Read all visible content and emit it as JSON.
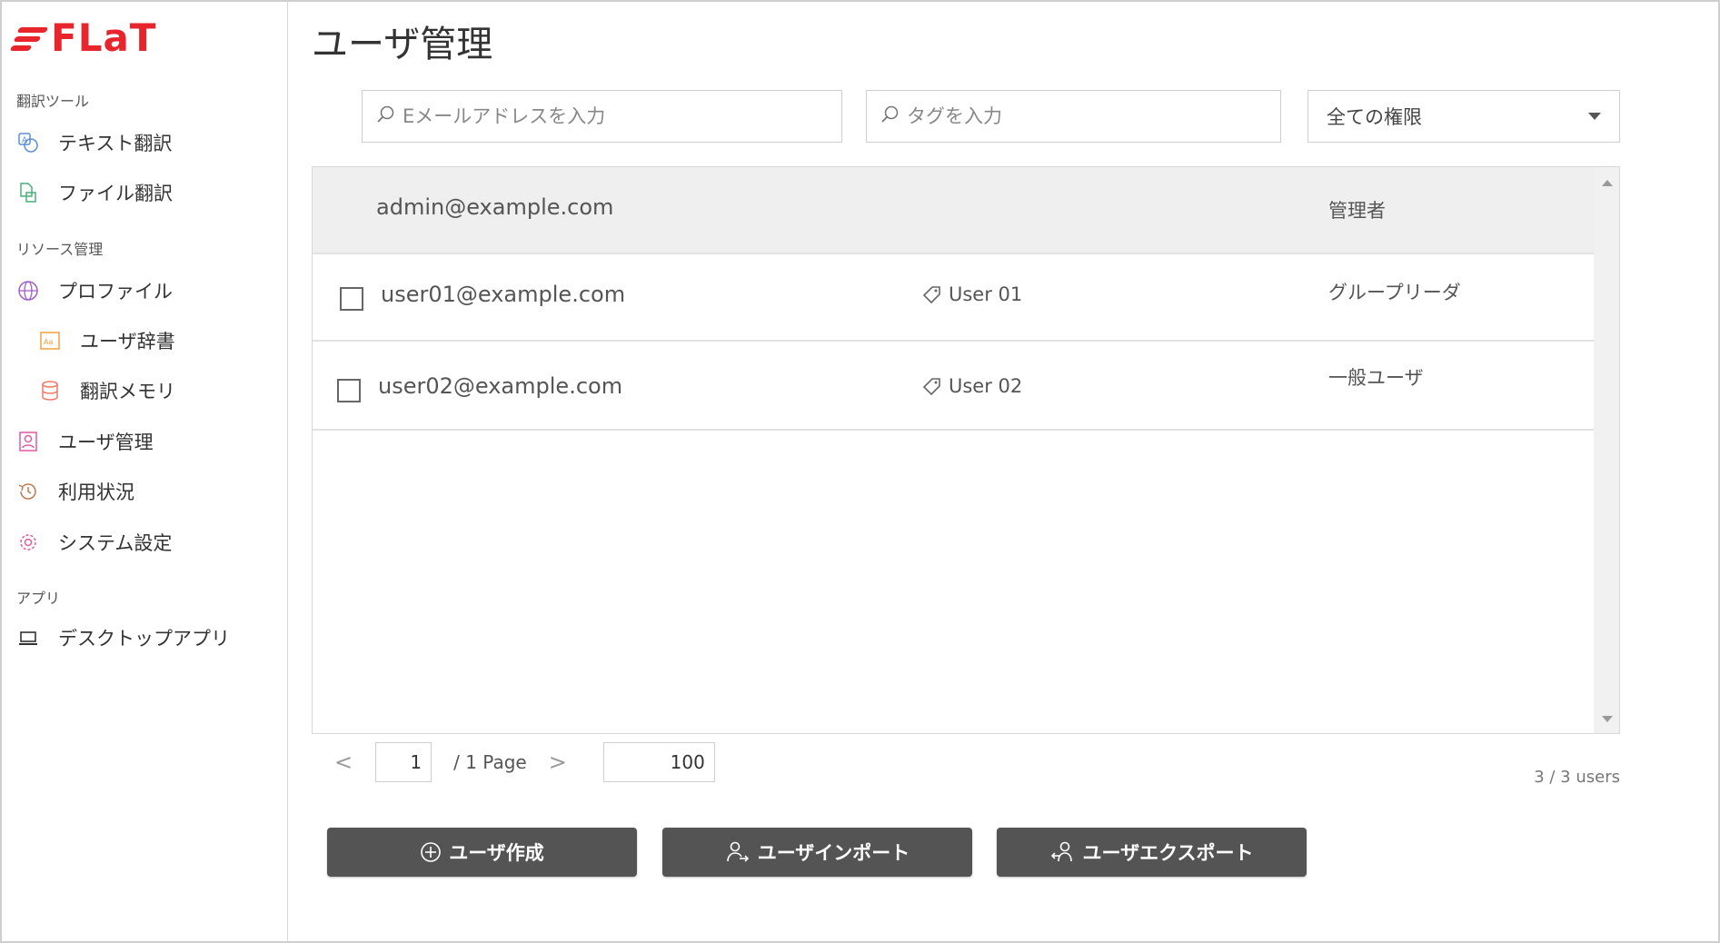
{
  "brand": {
    "name": "FLaT",
    "color": "#e8242c"
  },
  "sidebar": {
    "sections": [
      {
        "label": "翻訳ツール"
      },
      {
        "label": "リソース管理"
      },
      {
        "label": "アプリ"
      }
    ],
    "items": [
      {
        "label": "テキスト翻訳",
        "icon": "text-translate-icon"
      },
      {
        "label": "ファイル翻訳",
        "icon": "file-translate-icon"
      },
      {
        "label": "プロファイル",
        "icon": "globe-icon"
      },
      {
        "label": "ユーザ辞書",
        "icon": "dictionary-icon"
      },
      {
        "label": "翻訳メモリ",
        "icon": "database-icon"
      },
      {
        "label": "ユーザ管理",
        "icon": "user-card-icon"
      },
      {
        "label": "利用状況",
        "icon": "history-icon"
      },
      {
        "label": "システム設定",
        "icon": "gear-icon"
      },
      {
        "label": "デスクトップアプリ",
        "icon": "laptop-icon"
      }
    ]
  },
  "main": {
    "title": "ユーザ管理",
    "email_search": {
      "placeholder": "Eメールアドレスを入力",
      "value": ""
    },
    "tag_search": {
      "placeholder": "タグを入力",
      "value": ""
    },
    "role_filter": {
      "selected": "全ての権限"
    },
    "table": {
      "header_row": {
        "email": "admin@example.com",
        "role": "管理者"
      },
      "rows": [
        {
          "email": "user01@example.com",
          "tag": "User 01",
          "role": "グループリーダ",
          "checked": false
        },
        {
          "email": "user02@example.com",
          "tag": "User 02",
          "role": "一般ユーザ",
          "checked": false
        }
      ]
    },
    "pagination": {
      "prev": "<",
      "current_page": "1",
      "page_suffix": "/ 1 Page",
      "next": ">",
      "page_size": "100"
    },
    "user_count": "3 / 3 users",
    "buttons": {
      "create": "ユーザ作成",
      "import": "ユーザインポート",
      "export": "ユーザエクスポート"
    }
  }
}
